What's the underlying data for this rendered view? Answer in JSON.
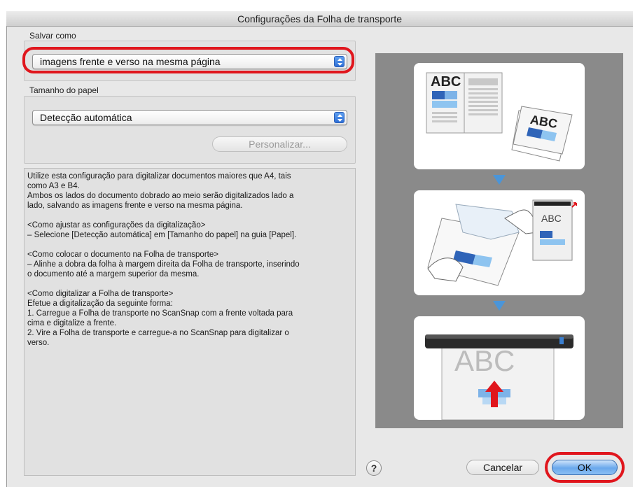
{
  "window": {
    "title": "Configurações da Folha de transporte"
  },
  "save_as": {
    "label": "Salvar como",
    "value": "imagens frente e verso na mesma página"
  },
  "paper_size": {
    "label": "Tamanho do papel",
    "value": "Detecção automática",
    "customize_label": "Personalizar..."
  },
  "description": {
    "lines": [
      "Utilize esta configuração para digitalizar documentos maiores que A4, tais",
      "como A3 e B4.",
      "Ambos os lados do documento dobrado ao meio serão digitalizados lado a",
      "lado, salvando as imagens frente e verso na mesma página.",
      "",
      "<Como ajustar as configurações da digitalização>",
      "– Selecione [Detecção automática] em [Tamanho do papel] na guia [Papel].",
      "",
      "<Como colocar o documento na Folha de transporte>",
      "– Alinhe a dobra da folha à margem direita da Folha de transporte, inserindo",
      "o documento até a margem superior da mesma.",
      "",
      "<Como digitalizar a Folha de transporte>",
      "Efetue a digitalização da seguinte forma:",
      "1. Carregue a Folha de transporte no ScanSnap com a frente voltada para",
      "cima e digitalize a frente.",
      "2. Vire a Folha de transporte e carregue-a no ScanSnap para digitalizar o",
      "verso."
    ]
  },
  "preview": {
    "panel1_doc_text": "ABC",
    "panel1_card_text": "ABC",
    "panel2_doc_text": "ABC",
    "panel3_doc_text": "ABC"
  },
  "buttons": {
    "help": "?",
    "cancel": "Cancelar",
    "ok": "OK"
  },
  "colors": {
    "highlight": "#e0161d",
    "accent": "#4b95d8"
  }
}
